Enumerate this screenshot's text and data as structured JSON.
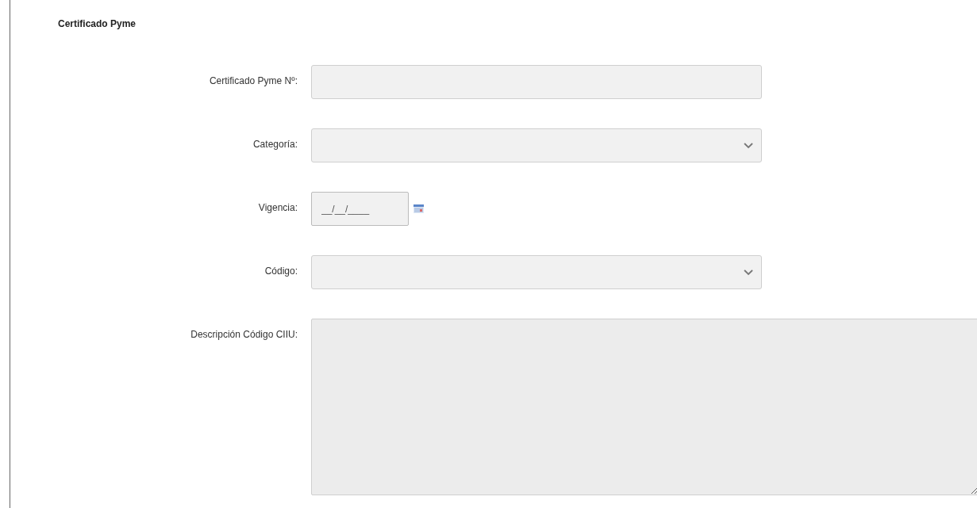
{
  "section_title": "Certificado Pyme",
  "fields": [
    {
      "kind": "text",
      "label": "Certificado Pyme Nº:"
    },
    {
      "kind": "select",
      "label": "Categoría:"
    },
    {
      "kind": "date",
      "label": "Vigencia:",
      "placeholder": "__/__/____"
    },
    {
      "kind": "select",
      "label": "Código:"
    },
    {
      "kind": "textarea",
      "label": "Descripción Código CIIU:"
    }
  ]
}
